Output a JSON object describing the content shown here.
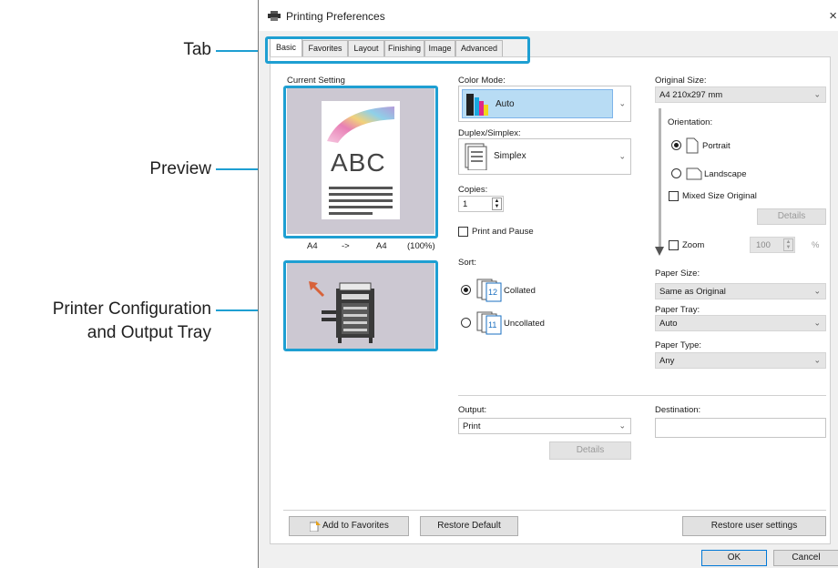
{
  "annotations": {
    "tab": "Tab",
    "preview": "Preview",
    "printer_config_line1": "Printer Configuration",
    "printer_config_line2": "and Output Tray"
  },
  "window": {
    "title": "Printing Preferences",
    "close_glyph": "×"
  },
  "tabs": [
    {
      "label": "Basic",
      "active": true
    },
    {
      "label": "Favorites",
      "active": false
    },
    {
      "label": "Layout",
      "active": false
    },
    {
      "label": "Finishing",
      "active": false
    },
    {
      "label": "Image",
      "active": false
    },
    {
      "label": "Advanced",
      "active": false
    }
  ],
  "current_setting": {
    "label": "Current Setting",
    "preview_text": "ABC",
    "size_from": "A4",
    "size_arrow": "->",
    "size_to": "A4",
    "scale": "(100%)"
  },
  "color_mode": {
    "label": "Color Mode:",
    "value": "Auto"
  },
  "duplex": {
    "label": "Duplex/Simplex:",
    "value": "Simplex"
  },
  "copies": {
    "label": "Copies:",
    "value": "1"
  },
  "print_and_pause": {
    "label": "Print and Pause",
    "checked": false
  },
  "sort": {
    "label": "Sort:",
    "options": [
      {
        "label": "Collated",
        "selected": true
      },
      {
        "label": "Uncollated",
        "selected": false
      }
    ]
  },
  "original_size": {
    "label": "Original Size:",
    "value": "A4 210x297 mm"
  },
  "orientation": {
    "label": "Orientation:",
    "portrait": "Portrait",
    "landscape": "Landscape",
    "selected": "Portrait"
  },
  "mixed_size": {
    "label": "Mixed Size Original",
    "checked": false,
    "details": "Details"
  },
  "zoom": {
    "label": "Zoom",
    "value": "100",
    "unit": "%",
    "checked": false
  },
  "paper_size": {
    "label": "Paper Size:",
    "value": "Same as Original"
  },
  "paper_tray": {
    "label": "Paper Tray:",
    "value": "Auto"
  },
  "paper_type": {
    "label": "Paper Type:",
    "value": "Any"
  },
  "output": {
    "label": "Output:",
    "value": "Print",
    "details": "Details"
  },
  "destination": {
    "label": "Destination:",
    "value": ""
  },
  "buttons": {
    "add_favorites": "Add to Favorites",
    "restore_default": "Restore Default",
    "restore_user": "Restore user settings",
    "ok": "OK",
    "cancel": "Cancel"
  },
  "colors": {
    "accent": "#1e9fd2",
    "selected_fill": "#b8dcf4",
    "preview_bg": "#ccc8d2"
  }
}
